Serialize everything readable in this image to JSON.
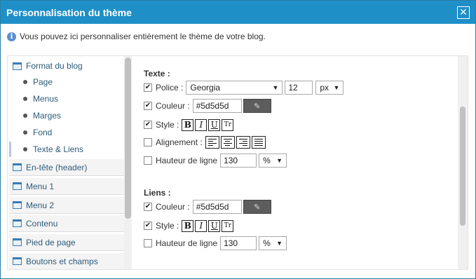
{
  "dialog": {
    "title": "Personnalisation du thème",
    "close_label": "✕",
    "info_icon": "i",
    "info_text": "Vous pouvez ici personnaliser entièrement le thème de votre blog."
  },
  "sidebar": {
    "first_category": {
      "label": "Format du blog",
      "icon": "layout-icon"
    },
    "sub_items": [
      {
        "label": "Page"
      },
      {
        "label": "Menus"
      },
      {
        "label": "Marges"
      },
      {
        "label": "Fond"
      },
      {
        "label": "Texte & Liens",
        "active": true
      }
    ],
    "categories": [
      {
        "label": "En-tête (header)",
        "icon": "layout-icon"
      },
      {
        "label": "Menu 1",
        "icon": "layout-icon"
      },
      {
        "label": "Menu 2",
        "icon": "layout-icon"
      },
      {
        "label": "Contenu",
        "icon": "layout-icon"
      },
      {
        "label": "Pied de page",
        "icon": "layout-icon"
      },
      {
        "label": "Boutons et champs",
        "icon": "form-icon"
      }
    ]
  },
  "texte": {
    "title": "Texte :",
    "police_label": "Police :",
    "police_value": "Georgia",
    "size_value": "12",
    "unit_value": "px",
    "couleur_label": "Couleur :",
    "couleur_value": "#5d5d5d",
    "style_label": "Style :",
    "style_buttons": [
      "B",
      "I",
      "U",
      "Tr"
    ],
    "alignement_label": "Alignement :",
    "hauteur_label": "Hauteur de ligne",
    "hauteur_value": "130",
    "hauteur_unit": "%",
    "police_checked": true,
    "couleur_checked": true,
    "style_checked": true,
    "alignement_checked": false,
    "hauteur_checked": false
  },
  "liens": {
    "title": "Liens :",
    "couleur_label": "Couleur :",
    "couleur_value": "#5d5d5d",
    "style_label": "Style :",
    "style_buttons": [
      "B",
      "I",
      "U",
      "Tr"
    ],
    "hauteur_label": "Hauteur de ligne",
    "hauteur_value": "130",
    "hauteur_unit": "%",
    "couleur_checked": true,
    "style_checked": true,
    "hauteur_checked": false
  },
  "colors": {
    "titlebar": "#1f8fc7",
    "swatch": "#5d5d5d",
    "link_text": "#2d5b7a"
  },
  "icons": {
    "checkmark": "✔",
    "select_arrow": "▼",
    "eyedropper": "✎"
  }
}
